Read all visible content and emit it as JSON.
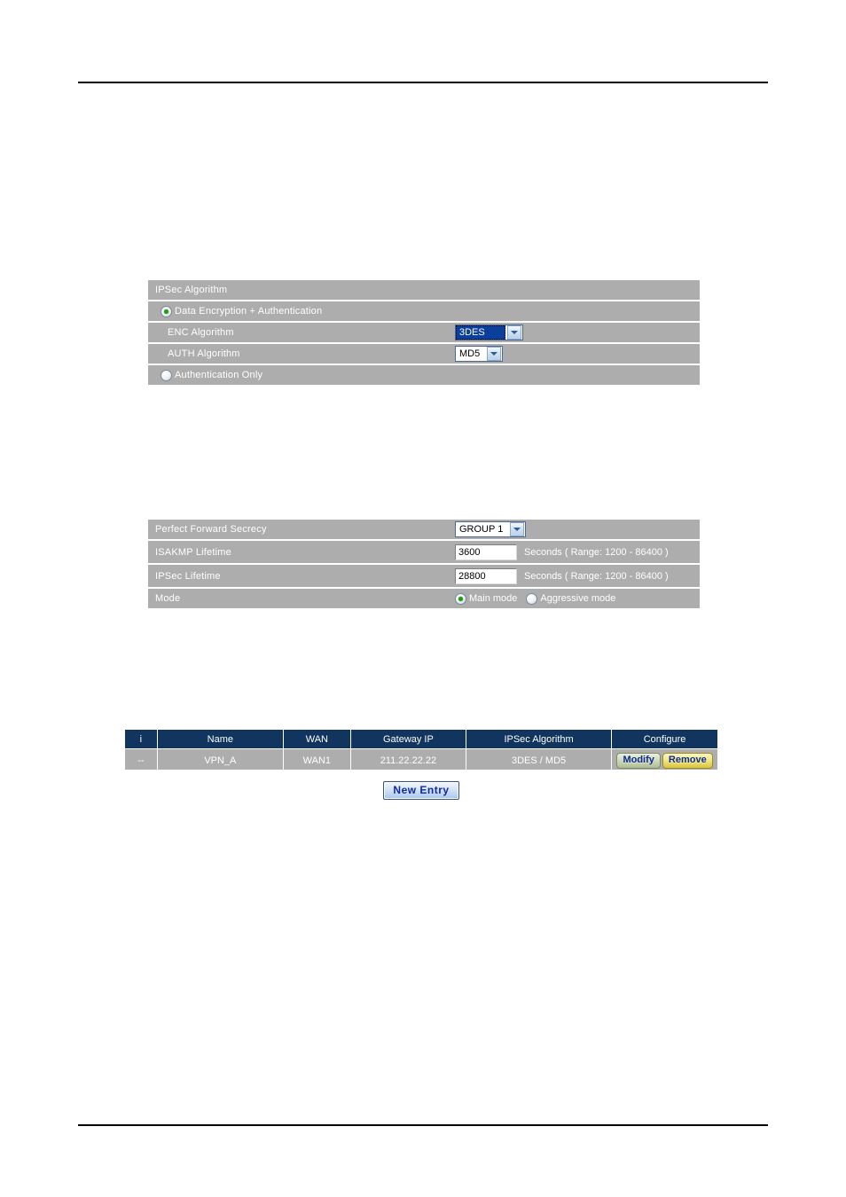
{
  "page": {
    "rules": [
      "top-rule",
      "bottom-rule"
    ]
  },
  "ipsec_algorithm_panel": {
    "header": "IPSec Algorithm",
    "option_encrypt_auth": {
      "label": "Data Encryption + Authentication",
      "selected": true
    },
    "enc_algorithm": {
      "label": "ENC Algorithm",
      "value": "3DES",
      "focused": true
    },
    "auth_algorithm": {
      "label": "AUTH Algorithm",
      "value": "MD5",
      "focused": false
    },
    "option_auth_only": {
      "label": "Authentication Only",
      "selected": false
    }
  },
  "ike_panel": {
    "pfs": {
      "label": "Perfect Forward Secrecy",
      "value": "GROUP 1"
    },
    "isakmp_lifetime": {
      "label": "ISAKMP Lifetime",
      "value": "3600",
      "unit": "Seconds  ( Range: 1200 - 86400 )"
    },
    "ipsec_lifetime": {
      "label": "IPSec Lifetime",
      "value": "28800",
      "unit": "Seconds  ( Range: 1200 - 86400 )"
    },
    "mode": {
      "label": "Mode",
      "options": [
        {
          "label": "Main mode",
          "selected": true
        },
        {
          "label": "Aggressive mode",
          "selected": false
        }
      ]
    }
  },
  "entry_table": {
    "columns": [
      "i",
      "Name",
      "WAN",
      "Gateway IP",
      "IPSec Algorithm",
      "Configure"
    ],
    "rows": [
      {
        "i": "--",
        "name": "VPN_A",
        "wan": "WAN1",
        "gateway_ip": "211.22.22.22",
        "ipsec_algorithm": "3DES / MD5",
        "modify_label": "Modify",
        "remove_label": "Remove"
      }
    ],
    "new_entry_label": "New Entry"
  },
  "colors": {
    "table_header": "#11355e",
    "row_gray": "#adadad",
    "select_highlight": "#0b3f9c",
    "radio_dot": "#1fa014"
  }
}
